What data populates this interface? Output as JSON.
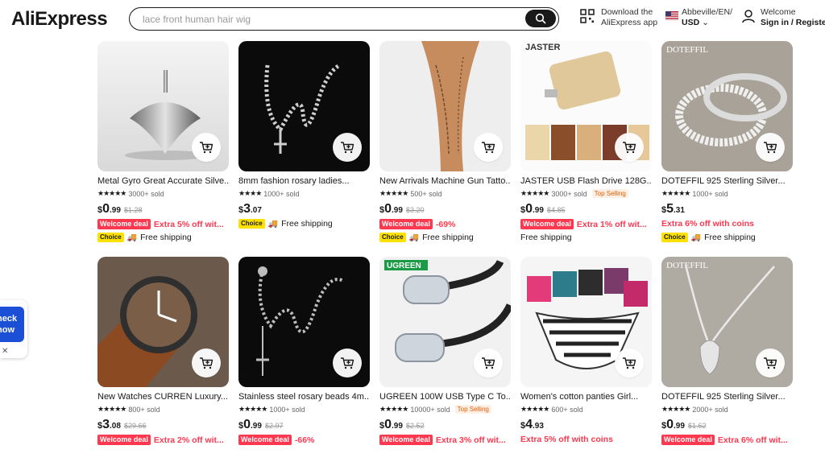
{
  "header": {
    "logo": "AliExpress",
    "search_placeholder": "lace front human hair wig",
    "app_line1": "Download the",
    "app_line2": "AliExpress app",
    "lang_line1": "Abbeville/EN/",
    "lang_line2": "USD",
    "account_line1": "Welcome",
    "account_line2": "Sign in / Register"
  },
  "floating_banner": {
    "line1": "heck",
    "line2": "now",
    "close": "✕"
  },
  "products": [
    {
      "title": "Metal Gyro Great Accurate Silve...",
      "sold": "3000+ sold",
      "stars": 4.5,
      "top": "",
      "cur": "$",
      "int": "0",
      "dec": ".99",
      "orig": "$1.28",
      "welcome": "Welcome deal",
      "deal": "Extra 5% off wit...",
      "choice": "Choice",
      "ship": "Free shipping",
      "img": "gyro"
    },
    {
      "title": "8mm fashion rosary ladies...",
      "sold": "1000+ sold",
      "stars": 4.0,
      "top": "",
      "cur": "$",
      "int": "3",
      "dec": ".07",
      "orig": "",
      "welcome": "",
      "deal": "",
      "choice": "Choice",
      "ship": "Free shipping",
      "img": "rosary"
    },
    {
      "title": "New Arrivals Machine Gun Tatto...",
      "sold": "500+ sold",
      "stars": 4.5,
      "top": "",
      "cur": "$",
      "int": "0",
      "dec": ".99",
      "orig": "$3.20",
      "welcome": "Welcome deal",
      "deal": "-69%",
      "choice": "Choice",
      "ship": "Free shipping",
      "img": "tattoo"
    },
    {
      "title": "JASTER USB Flash Drive 128G...",
      "sold": "3000+ sold",
      "stars": 4.5,
      "top": "Top Selling",
      "cur": "$",
      "int": "0",
      "dec": ".99",
      "orig": "$4.85",
      "welcome": "Welcome deal",
      "deal": "Extra 1% off wit...",
      "choice": "",
      "ship": "Free shipping",
      "img": "usb"
    },
    {
      "title": "DOTEFFIL 925 Sterling Silver...",
      "sold": "1000+ sold",
      "stars": 4.5,
      "top": "",
      "cur": "$",
      "int": "5",
      "dec": ".31",
      "orig": "",
      "welcome": "",
      "deal": "Extra 6% off with coins",
      "choice": "Choice",
      "ship": "Free shipping",
      "img": "bracelet"
    },
    {
      "title": "New Watches CURREN Luxury...",
      "sold": "800+ sold",
      "stars": 4.5,
      "top": "",
      "cur": "$",
      "int": "3",
      "dec": ".08",
      "orig": "$29.66",
      "welcome": "Welcome deal",
      "deal": "Extra 2% off wit...",
      "choice": "",
      "ship": "",
      "img": "watch"
    },
    {
      "title": "Stainless steel rosary beads 4m...",
      "sold": "1000+ sold",
      "stars": 4.5,
      "top": "",
      "cur": "$",
      "int": "0",
      "dec": ".99",
      "orig": "$2.97",
      "welcome": "Welcome deal",
      "deal": "-66%",
      "choice": "",
      "ship": "",
      "img": "rosary2"
    },
    {
      "title": "UGREEN 100W USB Type C To...",
      "sold": "10000+ sold",
      "stars": 4.5,
      "top": "Top Selling",
      "cur": "$",
      "int": "0",
      "dec": ".99",
      "orig": "$2.52",
      "welcome": "Welcome deal",
      "deal": "Extra 3% off wit...",
      "choice": "",
      "ship": "",
      "img": "cable"
    },
    {
      "title": "Women's cotton panties Girl...",
      "sold": "600+ sold",
      "stars": 4.5,
      "top": "",
      "cur": "$",
      "int": "4",
      "dec": ".93",
      "orig": "",
      "welcome": "",
      "deal": "Extra 5% off with coins",
      "choice": "",
      "ship": "",
      "img": "panties"
    },
    {
      "title": "DOTEFFIL 925 Sterling Silver...",
      "sold": "2000+ sold",
      "stars": 4.5,
      "top": "",
      "cur": "$",
      "int": "0",
      "dec": ".99",
      "orig": "$1.62",
      "welcome": "Welcome deal",
      "deal": "Extra 6% off wit...",
      "choice": "",
      "ship": "",
      "img": "necklace"
    }
  ],
  "image_labels": {
    "usb": "JASTER",
    "cable": "UGREEN",
    "bracelet": "DOTEFFIL",
    "necklace": "DOTEFFIL"
  },
  "colors": {
    "deal_red": "#fd384f",
    "choice_yellow": "#ffe100",
    "brand_dark": "#191919",
    "ugreen_green": "#1c9b47"
  }
}
